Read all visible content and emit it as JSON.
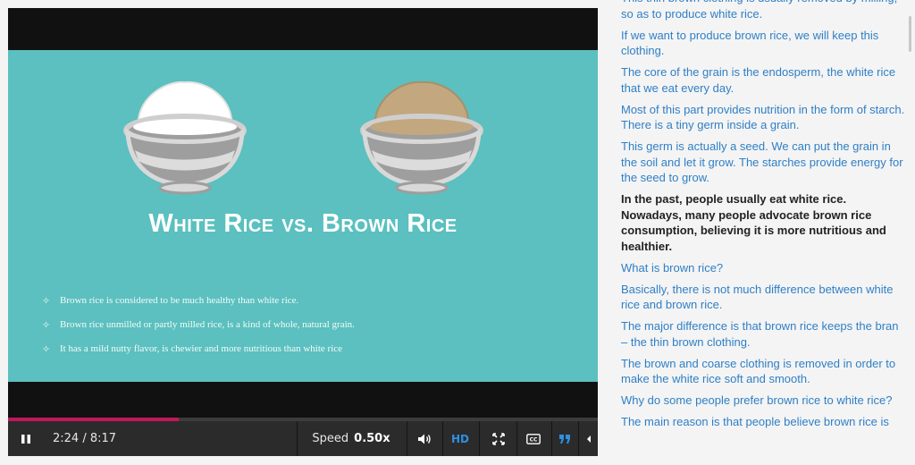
{
  "slide": {
    "title": "White Rice vs. Brown Rice",
    "bullets": [
      "Brown rice is considered to be much healthy than white rice.",
      "Brown rice unmilled or partly milled rice, is a kind of whole, natural grain.",
      "It has a mild nutty flavor, is chewier and more nutritious than white rice"
    ],
    "bullet_marker": "✧"
  },
  "player": {
    "time_display": "2:24 / 8:17",
    "progress_fraction": 0.29,
    "speed_label": "Speed",
    "speed_value": "0.50x",
    "hd_label": "HD",
    "icons": [
      "pause-icon",
      "speed-play-icon",
      "volume-icon",
      "fullscreen-icon",
      "closed-captions-icon",
      "transcript-quote-icon",
      "chevron-left-icon"
    ],
    "colors": {
      "progress": "#c2185b",
      "accent": "#2f8fe0",
      "slide_bg": "#5bc0bf"
    }
  },
  "transcript": {
    "cues": [
      "This thin brown clothing is usually removed by milling, so as to produce white rice.",
      "If we want to produce brown rice, we will keep this clothing.",
      "The core of the grain is the endosperm, the white rice that we eat every day.",
      "Most of this part provides nutrition in the form of starch. There is a tiny germ inside a grain.",
      "This germ is actually a seed. We can put the grain in the soil and let it grow. The starches provide energy for the seed to grow.",
      "In the past, people usually eat white rice. Nowadays, many people advocate brown rice consumption, believing it is more nutritious and healthier.",
      "What is brown rice?",
      "Basically, there is not much difference between white rice and brown rice.",
      "The major difference is that brown rice keeps the bran – the thin brown clothing.",
      "The brown and coarse clothing is removed in order to make the white rice soft and smooth.",
      "Why do some people prefer brown rice to white rice?",
      "The main reason is that people believe brown rice is"
    ],
    "active_index": 5
  }
}
